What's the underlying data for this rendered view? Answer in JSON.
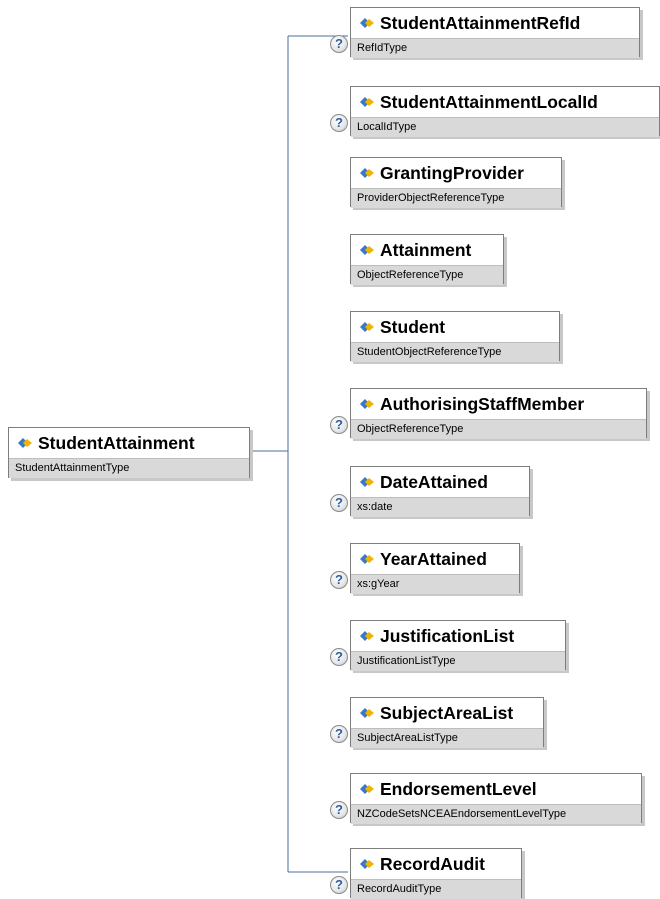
{
  "root": {
    "name": "StudentAttainment",
    "type": "StudentAttainmentType"
  },
  "optional_marker": "?",
  "children": [
    {
      "name": "StudentAttainmentRefId",
      "type": "RefIdType",
      "optional": true
    },
    {
      "name": "StudentAttainmentLocalId",
      "type": "LocalIdType",
      "optional": true
    },
    {
      "name": "GrantingProvider",
      "type": "ProviderObjectReferenceType",
      "optional": false
    },
    {
      "name": "Attainment",
      "type": "ObjectReferenceType",
      "optional": false
    },
    {
      "name": "Student",
      "type": "StudentObjectReferenceType",
      "optional": false
    },
    {
      "name": "AuthorisingStaffMember",
      "type": "ObjectReferenceType",
      "optional": true
    },
    {
      "name": "DateAttained",
      "type": "xs:date",
      "optional": true
    },
    {
      "name": "YearAttained",
      "type": "xs:gYear",
      "optional": true
    },
    {
      "name": "JustificationList",
      "type": "JustificationListType",
      "optional": true
    },
    {
      "name": "SubjectAreaList",
      "type": "SubjectAreaListType",
      "optional": true
    },
    {
      "name": "EndorsementLevel",
      "type": "NZCodeSetsNCEAEndorsementLevelType",
      "optional": true
    },
    {
      "name": "RecordAudit",
      "type": "RecordAuditType",
      "optional": true
    }
  ]
}
